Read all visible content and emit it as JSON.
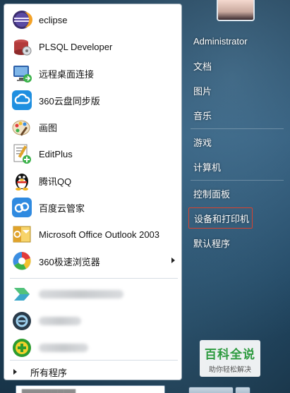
{
  "programs": [
    {
      "label": "eclipse",
      "icon": "eclipse-icon"
    },
    {
      "label": "PLSQL Developer",
      "icon": "plsql-developer-icon"
    },
    {
      "label": "远程桌面连接",
      "icon": "remote-desktop-icon"
    },
    {
      "label": "360云盘同步版",
      "icon": "cloud-sync-icon"
    },
    {
      "label": "画图",
      "icon": "paint-icon"
    },
    {
      "label": "EditPlus",
      "icon": "editplus-icon"
    },
    {
      "label": "腾讯QQ",
      "icon": "qq-penguin-icon"
    },
    {
      "label": "百度云管家",
      "icon": "baidu-cloud-icon"
    },
    {
      "label": "Microsoft Office Outlook 2003",
      "icon": "outlook-icon"
    },
    {
      "label": "360极速浏览器",
      "icon": "browser-icon"
    }
  ],
  "all_programs_label": "所有程序",
  "right_menu": [
    "Administrator",
    "文档",
    "图片",
    "音乐",
    "游戏",
    "计算机",
    "控制面板",
    "设备和打印机",
    "默认程序"
  ],
  "watermark": {
    "title": "百科全说",
    "subtitle": "助你轻松解决"
  },
  "colors": {
    "highlight_border": "#d9432f",
    "brand_green": "#2c9a3e"
  }
}
